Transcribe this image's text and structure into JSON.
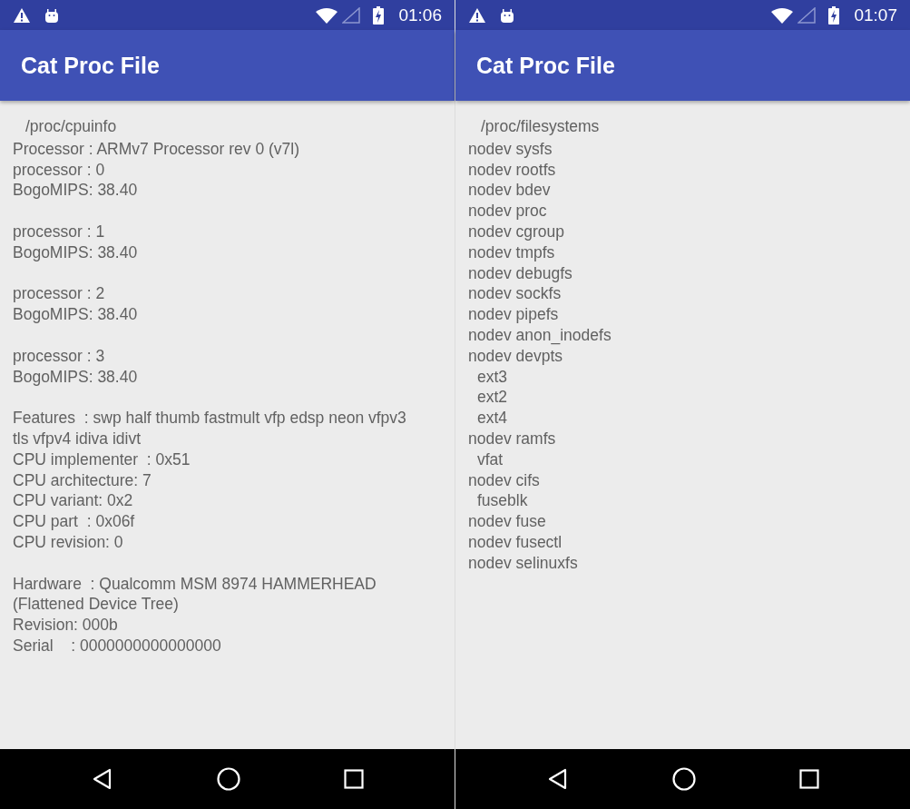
{
  "screens": [
    {
      "status_bar": {
        "time": "01:06"
      },
      "app_bar": {
        "title": "Cat Proc File"
      },
      "file_path": "/proc/cpuinfo",
      "blocks": [
        [
          {
            "text": "Processor : ARMv7 Processor rev 0 (v7l)",
            "kind": "plain"
          },
          {
            "text": "processor : 0",
            "kind": "plain"
          },
          {
            "text": "BogoMIPS: 38.40",
            "kind": "plain"
          }
        ],
        [
          {
            "text": "processor : 1",
            "kind": "plain"
          },
          {
            "text": "BogoMIPS: 38.40",
            "kind": "plain"
          }
        ],
        [
          {
            "text": "processor : 2",
            "kind": "plain"
          },
          {
            "text": "BogoMIPS: 38.40",
            "kind": "plain"
          }
        ],
        [
          {
            "text": "processor : 3",
            "kind": "plain"
          },
          {
            "text": "BogoMIPS: 38.40",
            "kind": "plain"
          }
        ],
        [
          {
            "text": "Features  : swp half thumb fastmult vfp edsp neon vfpv3 tls vfpv4 idiva idivt",
            "kind": "plain"
          },
          {
            "text": "CPU implementer  : 0x51",
            "kind": "plain"
          },
          {
            "text": "CPU architecture: 7",
            "kind": "plain"
          },
          {
            "text": "CPU variant: 0x2",
            "kind": "plain"
          },
          {
            "text": "CPU part  : 0x06f",
            "kind": "plain"
          },
          {
            "text": "CPU revision: 0",
            "kind": "plain"
          }
        ],
        [
          {
            "text": "Hardware  : Qualcomm MSM 8974 HAMMERHEAD (Flattened Device Tree)",
            "kind": "plain"
          },
          {
            "text": "Revision: 000b",
            "kind": "plain"
          },
          {
            "text": "Serial    : 0000000000000000",
            "kind": "plain"
          }
        ]
      ]
    },
    {
      "status_bar": {
        "time": "01:07"
      },
      "app_bar": {
        "title": "Cat Proc File"
      },
      "file_path": "/proc/filesystems",
      "blocks": [
        [
          {
            "text": "nodev sysfs",
            "kind": "plain"
          },
          {
            "text": "nodev rootfs",
            "kind": "plain"
          },
          {
            "text": "nodev bdev",
            "kind": "plain"
          },
          {
            "text": "nodev proc",
            "kind": "plain"
          },
          {
            "text": "nodev cgroup",
            "kind": "plain"
          },
          {
            "text": "nodev tmpfs",
            "kind": "plain"
          },
          {
            "text": "nodev debugfs",
            "kind": "plain"
          },
          {
            "text": "nodev sockfs",
            "kind": "plain"
          },
          {
            "text": "nodev pipefs",
            "kind": "plain"
          },
          {
            "text": "nodev anon_inodefs",
            "kind": "plain"
          },
          {
            "text": "nodev devpts",
            "kind": "plain"
          },
          {
            "text": "ext3",
            "kind": "indented"
          },
          {
            "text": "ext2",
            "kind": "indented"
          },
          {
            "text": "ext4",
            "kind": "indented"
          },
          {
            "text": "nodev ramfs",
            "kind": "plain"
          },
          {
            "text": "vfat",
            "kind": "indented"
          },
          {
            "text": "nodev cifs",
            "kind": "plain"
          },
          {
            "text": "fuseblk",
            "kind": "indented"
          },
          {
            "text": "nodev fuse",
            "kind": "plain"
          },
          {
            "text": "nodev fusectl",
            "kind": "plain"
          },
          {
            "text": "nodev selinuxfs",
            "kind": "plain"
          }
        ]
      ]
    }
  ]
}
